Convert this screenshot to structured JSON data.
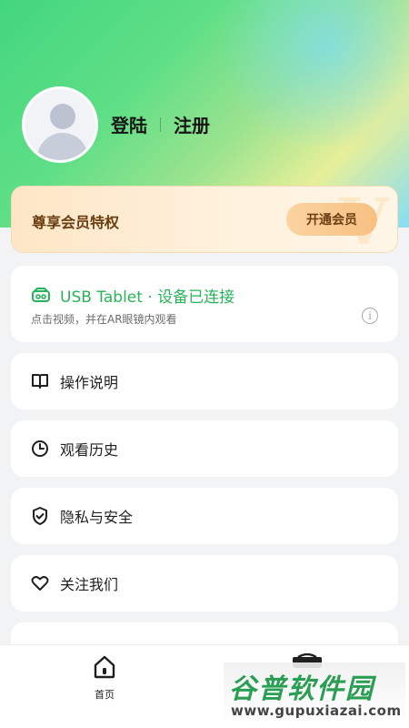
{
  "profile": {
    "login_label": "登陆",
    "register_label": "注册"
  },
  "vip": {
    "title": "尊享会员特权",
    "button_label": "开通会员",
    "watermark_letter": "V"
  },
  "device": {
    "status": "USB Tablet · 设备已连接",
    "hint": "点击视频，并在AR眼镜内观看",
    "info_icon": "i"
  },
  "menu": [
    {
      "label": "操作说明",
      "icon": "book-icon"
    },
    {
      "label": "观看历史",
      "icon": "clock-icon"
    },
    {
      "label": "隐私与安全",
      "icon": "shield-icon"
    },
    {
      "label": "关注我们",
      "icon": "heart-icon"
    }
  ],
  "nav": {
    "home_label": "首页"
  },
  "watermark": {
    "cn": "谷普软件园",
    "url": "www.gupuxiazai.com"
  },
  "colors": {
    "accent_green": "#27b35a",
    "vip_brown": "#6b3f12"
  }
}
